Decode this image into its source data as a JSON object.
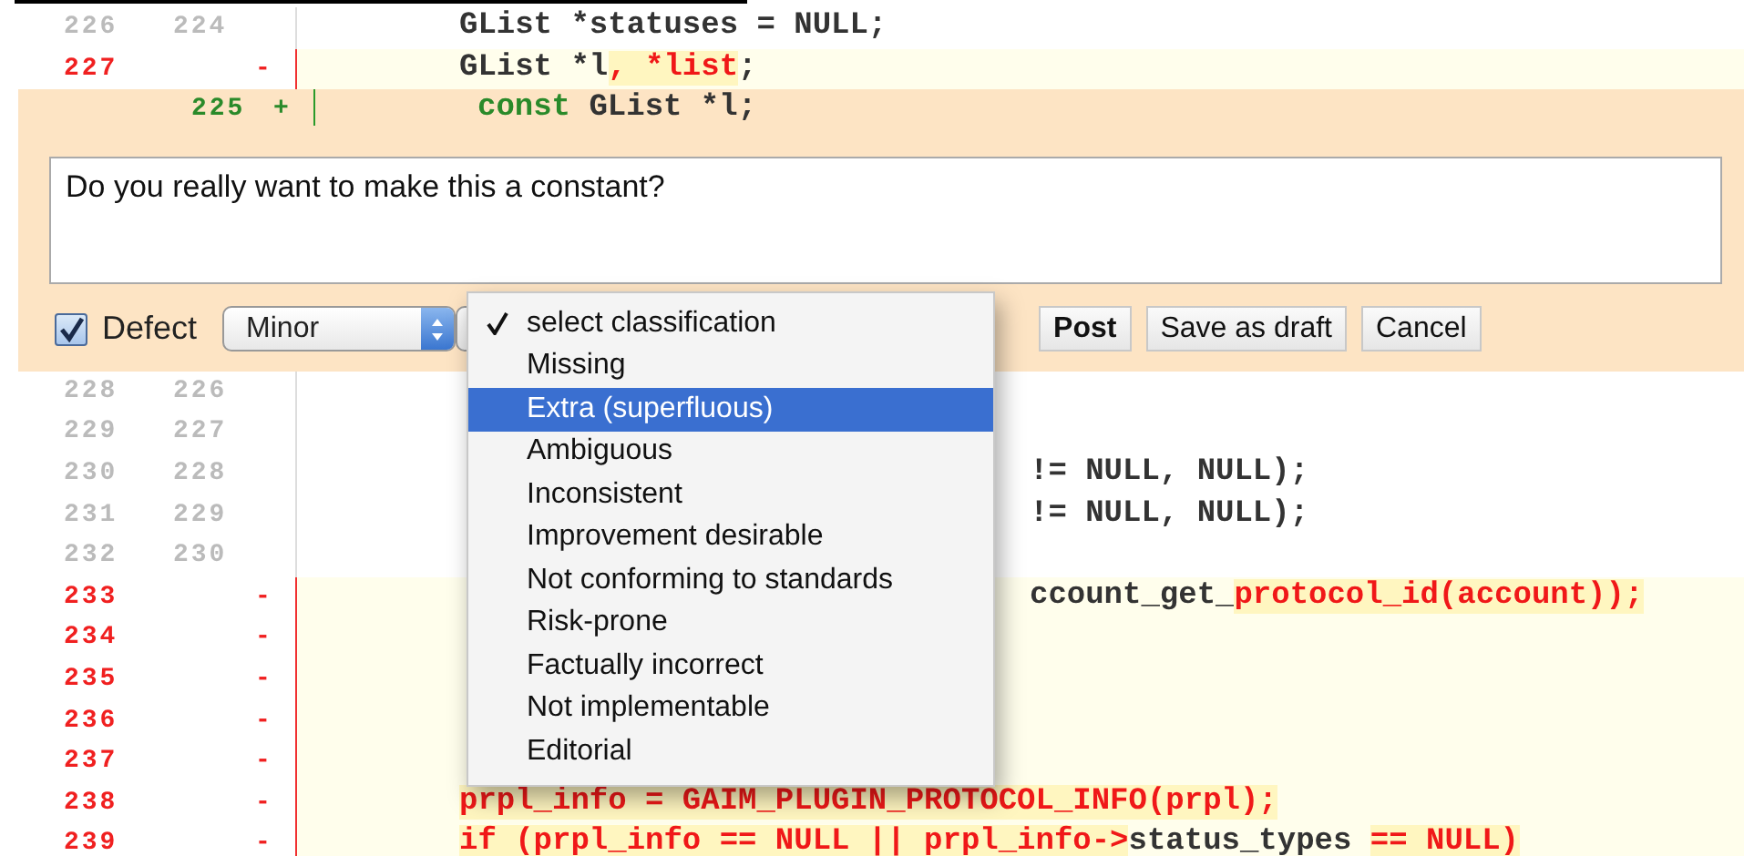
{
  "diff_top": [
    {
      "kind": "context",
      "old": "226",
      "new": "224",
      "code": [
        {
          "kind": "plain",
          "text": "GList *statuses = NULL;"
        }
      ]
    },
    {
      "kind": "removed",
      "old": "227",
      "sign": "-",
      "code": [
        {
          "kind": "plain",
          "text": "GList *l"
        },
        {
          "kind": "changed",
          "text": ", *list"
        },
        {
          "kind": "plain",
          "text": ";"
        }
      ]
    }
  ],
  "comment": {
    "row": {
      "kind": "added",
      "new": "225",
      "sign": "+",
      "code": [
        {
          "kind": "added",
          "text": "const"
        },
        {
          "kind": "plain",
          "text": " GList *l;"
        }
      ]
    },
    "text": "Do you really want to make this a constant?",
    "defect": {
      "label": "Defect",
      "checked": true
    },
    "severity": {
      "value": "Minor"
    },
    "buttons": [
      "Post",
      "Save as draft",
      "Cancel"
    ]
  },
  "diff_bottom": [
    {
      "kind": "context",
      "old": "228",
      "new": "226"
    },
    {
      "kind": "context",
      "old": "229",
      "new": "227"
    },
    {
      "kind": "context",
      "old": "230",
      "new": "228",
      "trailing": [
        {
          "kind": "plain",
          "text": "!= NULL, NULL);"
        }
      ]
    },
    {
      "kind": "context",
      "old": "231",
      "new": "229",
      "trailing": [
        {
          "kind": "plain",
          "text": "!= NULL, NULL);"
        }
      ]
    },
    {
      "kind": "context",
      "old": "232",
      "new": "230"
    },
    {
      "kind": "removed",
      "old": "233",
      "sign": "-",
      "trailing": [
        {
          "kind": "plain",
          "text": "ccount_get_"
        },
        {
          "kind": "changed",
          "text": "protocol_id(account));"
        }
      ]
    },
    {
      "kind": "removed",
      "old": "234",
      "sign": "-"
    },
    {
      "kind": "removed",
      "old": "235",
      "sign": "-"
    },
    {
      "kind": "removed",
      "old": "236",
      "sign": "-"
    },
    {
      "kind": "removed",
      "old": "237",
      "sign": "-"
    },
    {
      "kind": "removed",
      "old": "238",
      "sign": "-",
      "code": [
        {
          "kind": "changed",
          "text": "prpl_info = GAIM_PLUGIN_PROTOCOL_INFO(prpl);"
        }
      ]
    },
    {
      "kind": "removed",
      "old": "239",
      "sign": "-",
      "code": [
        {
          "kind": "changed",
          "text": "if (prpl_info == NULL || prpl_info->"
        },
        {
          "kind": "plain",
          "text": "status_types "
        },
        {
          "kind": "changed",
          "text": "== NULL)"
        }
      ]
    }
  ],
  "classification_menu": {
    "items": [
      {
        "label": "select classification",
        "checked": true,
        "highlighted": false
      },
      {
        "label": "Missing",
        "checked": false,
        "highlighted": false
      },
      {
        "label": "Extra (superfluous)",
        "checked": false,
        "highlighted": true
      },
      {
        "label": "Ambiguous",
        "checked": false,
        "highlighted": false
      },
      {
        "label": "Inconsistent",
        "checked": false,
        "highlighted": false
      },
      {
        "label": "Improvement desirable",
        "checked": false,
        "highlighted": false
      },
      {
        "label": "Not conforming to standards",
        "checked": false,
        "highlighted": false
      },
      {
        "label": "Risk-prone",
        "checked": false,
        "highlighted": false
      },
      {
        "label": "Factually incorrect",
        "checked": false,
        "highlighted": false
      },
      {
        "label": "Not implementable",
        "checked": false,
        "highlighted": false
      },
      {
        "label": "Editorial",
        "checked": false,
        "highlighted": false
      }
    ]
  }
}
